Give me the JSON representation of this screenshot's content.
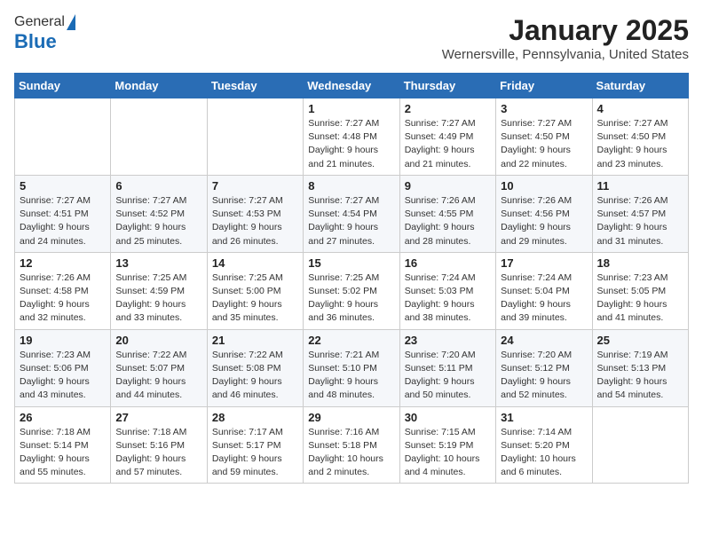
{
  "header": {
    "logo_general": "General",
    "logo_blue": "Blue",
    "month": "January 2025",
    "location": "Wernersville, Pennsylvania, United States"
  },
  "weekdays": [
    "Sunday",
    "Monday",
    "Tuesday",
    "Wednesday",
    "Thursday",
    "Friday",
    "Saturday"
  ],
  "weeks": [
    [
      {
        "day": "",
        "info": ""
      },
      {
        "day": "",
        "info": ""
      },
      {
        "day": "",
        "info": ""
      },
      {
        "day": "1",
        "info": "Sunrise: 7:27 AM\nSunset: 4:48 PM\nDaylight: 9 hours and 21 minutes."
      },
      {
        "day": "2",
        "info": "Sunrise: 7:27 AM\nSunset: 4:49 PM\nDaylight: 9 hours and 21 minutes."
      },
      {
        "day": "3",
        "info": "Sunrise: 7:27 AM\nSunset: 4:50 PM\nDaylight: 9 hours and 22 minutes."
      },
      {
        "day": "4",
        "info": "Sunrise: 7:27 AM\nSunset: 4:50 PM\nDaylight: 9 hours and 23 minutes."
      }
    ],
    [
      {
        "day": "5",
        "info": "Sunrise: 7:27 AM\nSunset: 4:51 PM\nDaylight: 9 hours and 24 minutes."
      },
      {
        "day": "6",
        "info": "Sunrise: 7:27 AM\nSunset: 4:52 PM\nDaylight: 9 hours and 25 minutes."
      },
      {
        "day": "7",
        "info": "Sunrise: 7:27 AM\nSunset: 4:53 PM\nDaylight: 9 hours and 26 minutes."
      },
      {
        "day": "8",
        "info": "Sunrise: 7:27 AM\nSunset: 4:54 PM\nDaylight: 9 hours and 27 minutes."
      },
      {
        "day": "9",
        "info": "Sunrise: 7:26 AM\nSunset: 4:55 PM\nDaylight: 9 hours and 28 minutes."
      },
      {
        "day": "10",
        "info": "Sunrise: 7:26 AM\nSunset: 4:56 PM\nDaylight: 9 hours and 29 minutes."
      },
      {
        "day": "11",
        "info": "Sunrise: 7:26 AM\nSunset: 4:57 PM\nDaylight: 9 hours and 31 minutes."
      }
    ],
    [
      {
        "day": "12",
        "info": "Sunrise: 7:26 AM\nSunset: 4:58 PM\nDaylight: 9 hours and 32 minutes."
      },
      {
        "day": "13",
        "info": "Sunrise: 7:25 AM\nSunset: 4:59 PM\nDaylight: 9 hours and 33 minutes."
      },
      {
        "day": "14",
        "info": "Sunrise: 7:25 AM\nSunset: 5:00 PM\nDaylight: 9 hours and 35 minutes."
      },
      {
        "day": "15",
        "info": "Sunrise: 7:25 AM\nSunset: 5:02 PM\nDaylight: 9 hours and 36 minutes."
      },
      {
        "day": "16",
        "info": "Sunrise: 7:24 AM\nSunset: 5:03 PM\nDaylight: 9 hours and 38 minutes."
      },
      {
        "day": "17",
        "info": "Sunrise: 7:24 AM\nSunset: 5:04 PM\nDaylight: 9 hours and 39 minutes."
      },
      {
        "day": "18",
        "info": "Sunrise: 7:23 AM\nSunset: 5:05 PM\nDaylight: 9 hours and 41 minutes."
      }
    ],
    [
      {
        "day": "19",
        "info": "Sunrise: 7:23 AM\nSunset: 5:06 PM\nDaylight: 9 hours and 43 minutes."
      },
      {
        "day": "20",
        "info": "Sunrise: 7:22 AM\nSunset: 5:07 PM\nDaylight: 9 hours and 44 minutes."
      },
      {
        "day": "21",
        "info": "Sunrise: 7:22 AM\nSunset: 5:08 PM\nDaylight: 9 hours and 46 minutes."
      },
      {
        "day": "22",
        "info": "Sunrise: 7:21 AM\nSunset: 5:10 PM\nDaylight: 9 hours and 48 minutes."
      },
      {
        "day": "23",
        "info": "Sunrise: 7:20 AM\nSunset: 5:11 PM\nDaylight: 9 hours and 50 minutes."
      },
      {
        "day": "24",
        "info": "Sunrise: 7:20 AM\nSunset: 5:12 PM\nDaylight: 9 hours and 52 minutes."
      },
      {
        "day": "25",
        "info": "Sunrise: 7:19 AM\nSunset: 5:13 PM\nDaylight: 9 hours and 54 minutes."
      }
    ],
    [
      {
        "day": "26",
        "info": "Sunrise: 7:18 AM\nSunset: 5:14 PM\nDaylight: 9 hours and 55 minutes."
      },
      {
        "day": "27",
        "info": "Sunrise: 7:18 AM\nSunset: 5:16 PM\nDaylight: 9 hours and 57 minutes."
      },
      {
        "day": "28",
        "info": "Sunrise: 7:17 AM\nSunset: 5:17 PM\nDaylight: 9 hours and 59 minutes."
      },
      {
        "day": "29",
        "info": "Sunrise: 7:16 AM\nSunset: 5:18 PM\nDaylight: 10 hours and 2 minutes."
      },
      {
        "day": "30",
        "info": "Sunrise: 7:15 AM\nSunset: 5:19 PM\nDaylight: 10 hours and 4 minutes."
      },
      {
        "day": "31",
        "info": "Sunrise: 7:14 AM\nSunset: 5:20 PM\nDaylight: 10 hours and 6 minutes."
      },
      {
        "day": "",
        "info": ""
      }
    ]
  ]
}
